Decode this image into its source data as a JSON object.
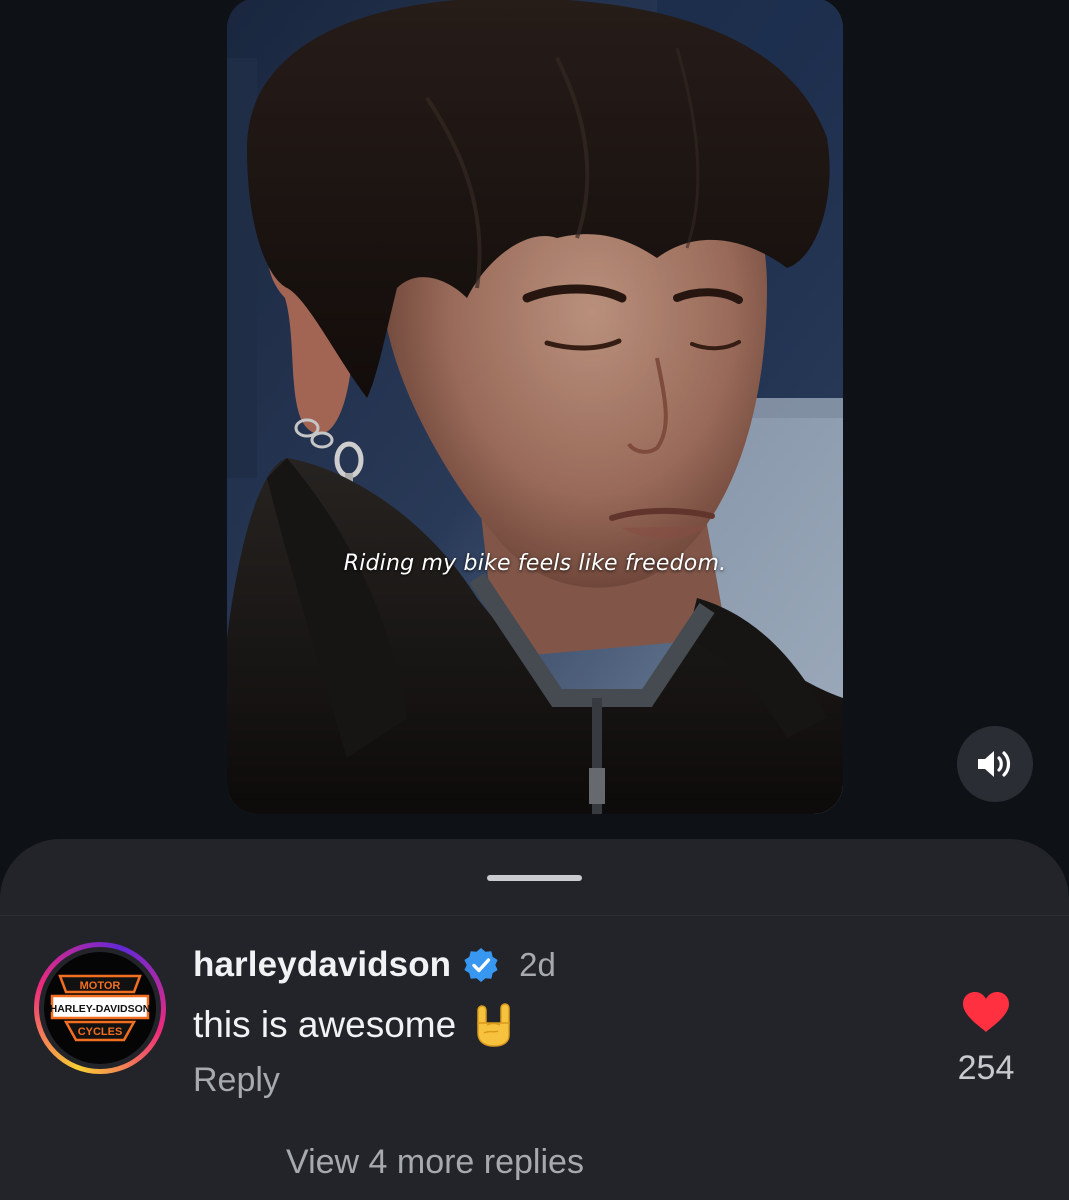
{
  "video": {
    "caption": "Riding my bike feels like freedom.",
    "sound_icon": "volume-icon"
  },
  "comment": {
    "avatar_logo": {
      "top": "MOTOR",
      "middle": "HARLEY-DAVIDSON",
      "bottom": "CYCLES"
    },
    "username": "harleydavidson",
    "verified_icon": "verified-badge-icon",
    "time": "2d",
    "text": "this is awesome",
    "emoji": "sign-of-horns-emoji",
    "reply_label": "Reply",
    "like_icon": "heart-icon",
    "like_count": "254",
    "liked": true,
    "view_replies_label": "View 4 more replies"
  },
  "colors": {
    "background": "#0e1115",
    "sheet": "#22242a",
    "heart": "#ff3040",
    "verified": "#3897f0",
    "muted_text": "#a6a9ae",
    "primary_text": "#f1f2f4"
  }
}
